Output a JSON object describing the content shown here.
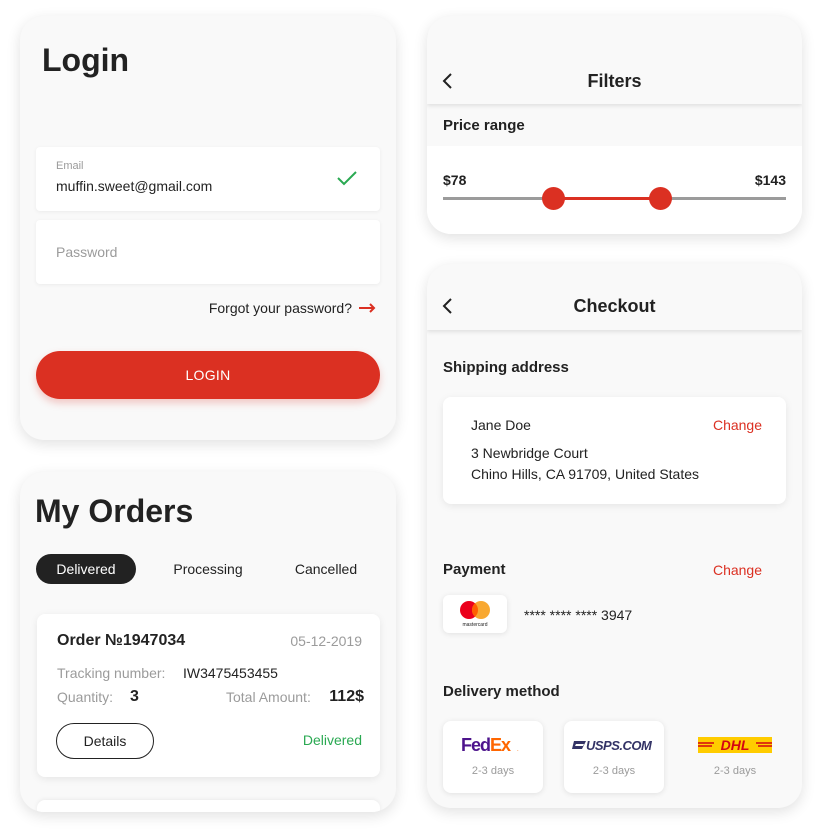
{
  "login": {
    "title": "Login",
    "email_label": "Email",
    "email_value": "muffin.sweet@gmail.com",
    "password_placeholder": "Password",
    "forgot": "Forgot your password?",
    "button": "LOGIN"
  },
  "orders": {
    "title": "My Orders",
    "tabs": [
      {
        "label": "Delivered",
        "active": true
      },
      {
        "label": "Processing",
        "active": false
      },
      {
        "label": "Cancelled",
        "active": false
      }
    ],
    "order": {
      "number": "Order №1947034",
      "date": "05-12-2019",
      "tracking_label": "Tracking number:",
      "tracking_value": "IW3475453455",
      "quantity_label": "Quantity:",
      "quantity_value": "3",
      "total_label": "Total Amount:",
      "total_value": "112$",
      "details_button": "Details",
      "status": "Delivered"
    }
  },
  "filters": {
    "title": "Filters",
    "price_label": "Price range",
    "price_min": "$78",
    "price_max": "$143"
  },
  "checkout": {
    "title": "Checkout",
    "shipping_title": "Shipping address",
    "address": {
      "name": "Jane Doe",
      "line1": "3 Newbridge Court",
      "line2": "Chino Hills, CA 91709, United States",
      "change": "Change"
    },
    "payment_title": "Payment",
    "payment_change": "Change",
    "card_brand": "mastercard",
    "card_number": "**** **** **** 3947",
    "delivery_title": "Delivery method",
    "carriers": [
      {
        "name": "FedEx",
        "days": "2-3 days"
      },
      {
        "name": "USPS.COM",
        "days": "2-3 days"
      },
      {
        "name": "DHL",
        "days": "2-3 days"
      }
    ]
  },
  "colors": {
    "accent": "#db3022",
    "dark": "#222222",
    "muted": "#9b9b9b",
    "success": "#2aa952",
    "card_bg": "#f9f9f9"
  }
}
